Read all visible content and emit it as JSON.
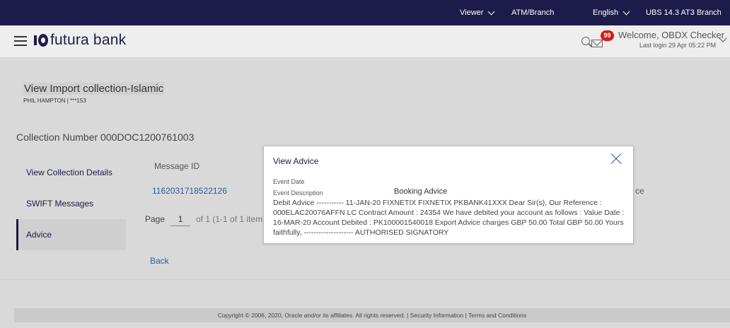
{
  "topbar": {
    "viewer": "Viewer",
    "atm_branch": "ATM/Branch",
    "language": "English",
    "branch": "UBS 14.3 AT3 Branch"
  },
  "header": {
    "logo_text": "futura bank",
    "notification_count": "99",
    "welcome": "Welcome, OBDX Checker",
    "last_login": "Last login 29 Apr 05:22 PM"
  },
  "page": {
    "title": "View Import collection-Islamic",
    "subtitle": "PHIL HAMPTON | ***153",
    "collection_number": "Collection Number 000DOC1200761003"
  },
  "nav": {
    "items": [
      {
        "label": "View Collection Details",
        "active": false
      },
      {
        "label": "SWIFT Messages",
        "active": false
      },
      {
        "label": "Advice",
        "active": true
      }
    ]
  },
  "table": {
    "header": "Message ID",
    "value": "1162031718522126",
    "partial_text": "ce"
  },
  "pagination": {
    "page_label": "Page",
    "page_number": "1",
    "of_text": "of 1  (1-1 of 1 item"
  },
  "back_label": "Back",
  "footer": "Copyright © 2006, 2020, Oracle and/or its affiliates. All rights reserved. | Security Information | Terms and Conditions",
  "modal": {
    "title": "View Advice",
    "event_date_label": "Event Date",
    "event_description_label": "Event Description",
    "event_description_value": "Booking Advice",
    "body": "Debit Advice ----------- 11-JAN-20 FIXNETIX FIXNETIX PKBANK41XXX Dear Sir(s), Our Reference : 000ELAC20076AFFN LC Contract Amount : 24354 We have debited your account as follows : Value Date : 16-MAR-20 Account Debited : PK100001540018 Export Advice charges GBP 50.00 Total GBP 50.00 Yours faithfully, -------------------- AUTHORISED SIGNATORY"
  },
  "icons": {
    "menu": "hamburger-menu-icon",
    "search": "search-icon",
    "mail": "mail-icon",
    "close": "close-icon"
  },
  "colors": {
    "topbar_bg": "#1c1b4a",
    "link": "#2e5a9e",
    "badge": "#d21b1b"
  }
}
